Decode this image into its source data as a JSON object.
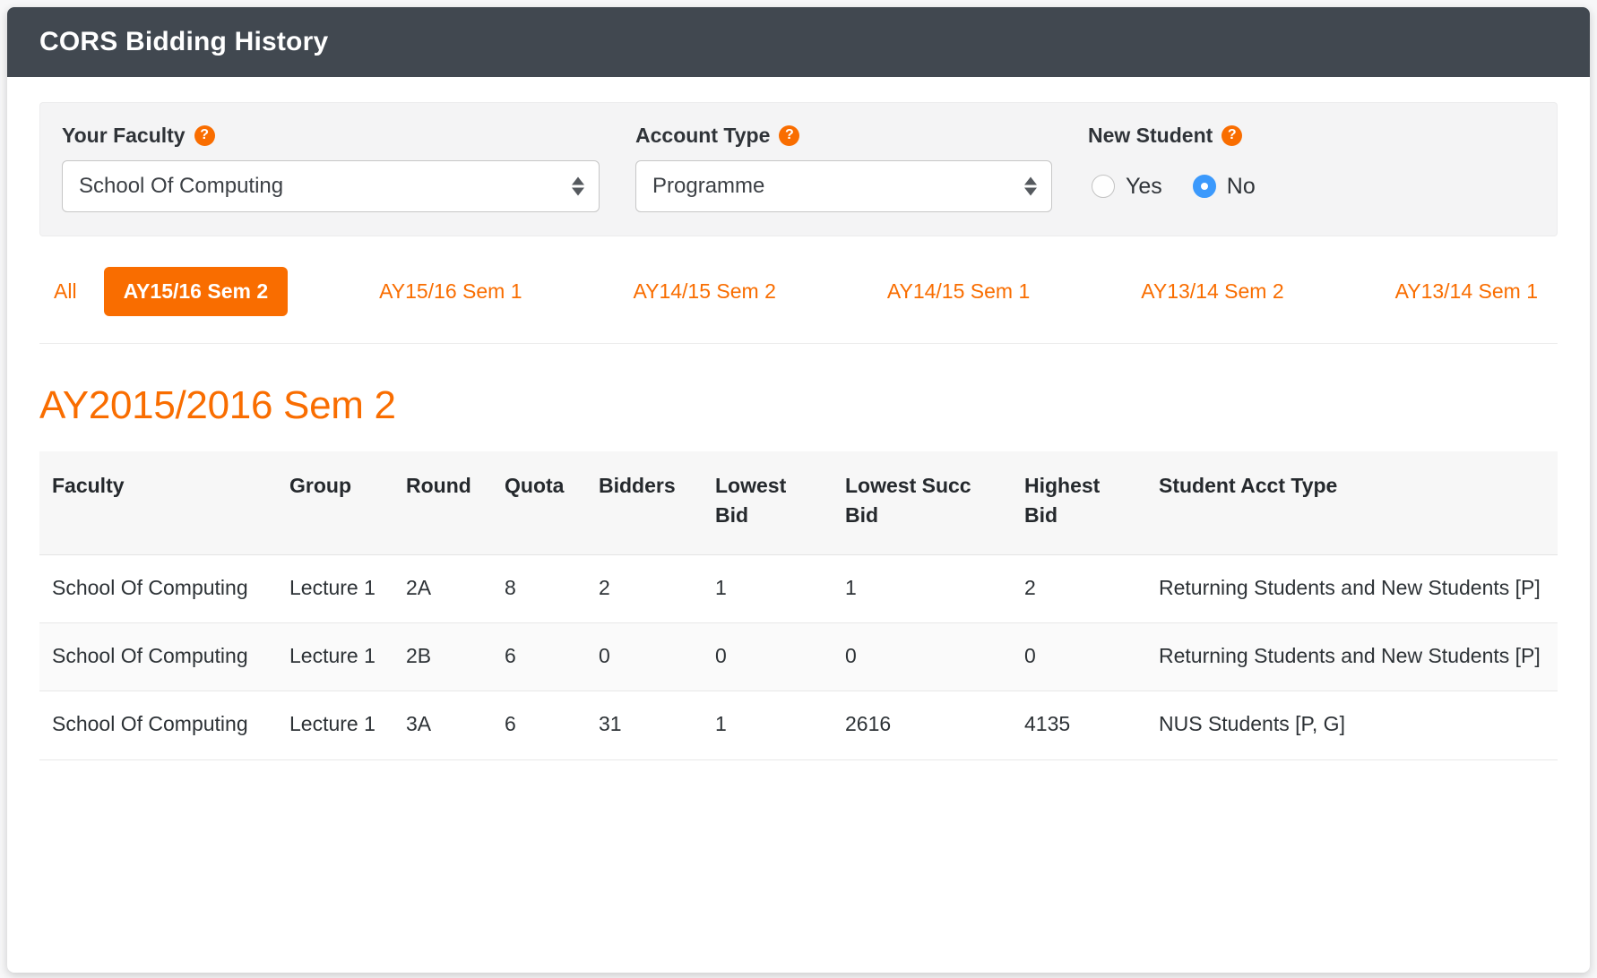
{
  "header": {
    "title": "CORS Bidding History"
  },
  "filters": {
    "faculty": {
      "label": "Your Faculty",
      "help": "?",
      "value": "School Of Computing"
    },
    "account_type": {
      "label": "Account Type",
      "help": "?",
      "value": "Programme"
    },
    "new_student": {
      "label": "New Student",
      "help": "?",
      "options": [
        {
          "label": "Yes",
          "checked": false
        },
        {
          "label": "No",
          "checked": true
        }
      ]
    }
  },
  "tabs": [
    {
      "label": "All",
      "active": false
    },
    {
      "label": "AY15/16 Sem 2",
      "active": true
    },
    {
      "label": "AY15/16 Sem 1",
      "active": false
    },
    {
      "label": "AY14/15 Sem 2",
      "active": false
    },
    {
      "label": "AY14/15 Sem 1",
      "active": false
    },
    {
      "label": "AY13/14 Sem 2",
      "active": false
    },
    {
      "label": "AY13/14 Sem 1",
      "active": false
    }
  ],
  "results": {
    "title": "AY2015/2016 Sem 2",
    "columns": [
      "Faculty",
      "Group",
      "Round",
      "Quota",
      "Bidders",
      "Lowest Bid",
      "Lowest Succ Bid",
      "Highest Bid",
      "Student Acct Type"
    ],
    "rows": [
      {
        "faculty": "School Of Computing",
        "group": "Lecture 1",
        "round": "2A",
        "quota": "8",
        "bidders": "2",
        "lowest_bid": "1",
        "lowest_succ_bid": "1",
        "highest_bid": "2",
        "student_acct_type": "Returning Students and New Students [P]"
      },
      {
        "faculty": "School Of Computing",
        "group": "Lecture 1",
        "round": "2B",
        "quota": "6",
        "bidders": "0",
        "lowest_bid": "0",
        "lowest_succ_bid": "0",
        "highest_bid": "0",
        "student_acct_type": "Returning Students and New Students [P]"
      },
      {
        "faculty": "School Of Computing",
        "group": "Lecture 1",
        "round": "3A",
        "quota": "6",
        "bidders": "31",
        "lowest_bid": "1",
        "lowest_succ_bid": "2616",
        "highest_bid": "4135",
        "student_acct_type": "NUS Students [P, G]"
      }
    ]
  },
  "colors": {
    "accent": "#f96d00",
    "header_bg": "#414850",
    "radio_selected": "#3b99fc"
  }
}
